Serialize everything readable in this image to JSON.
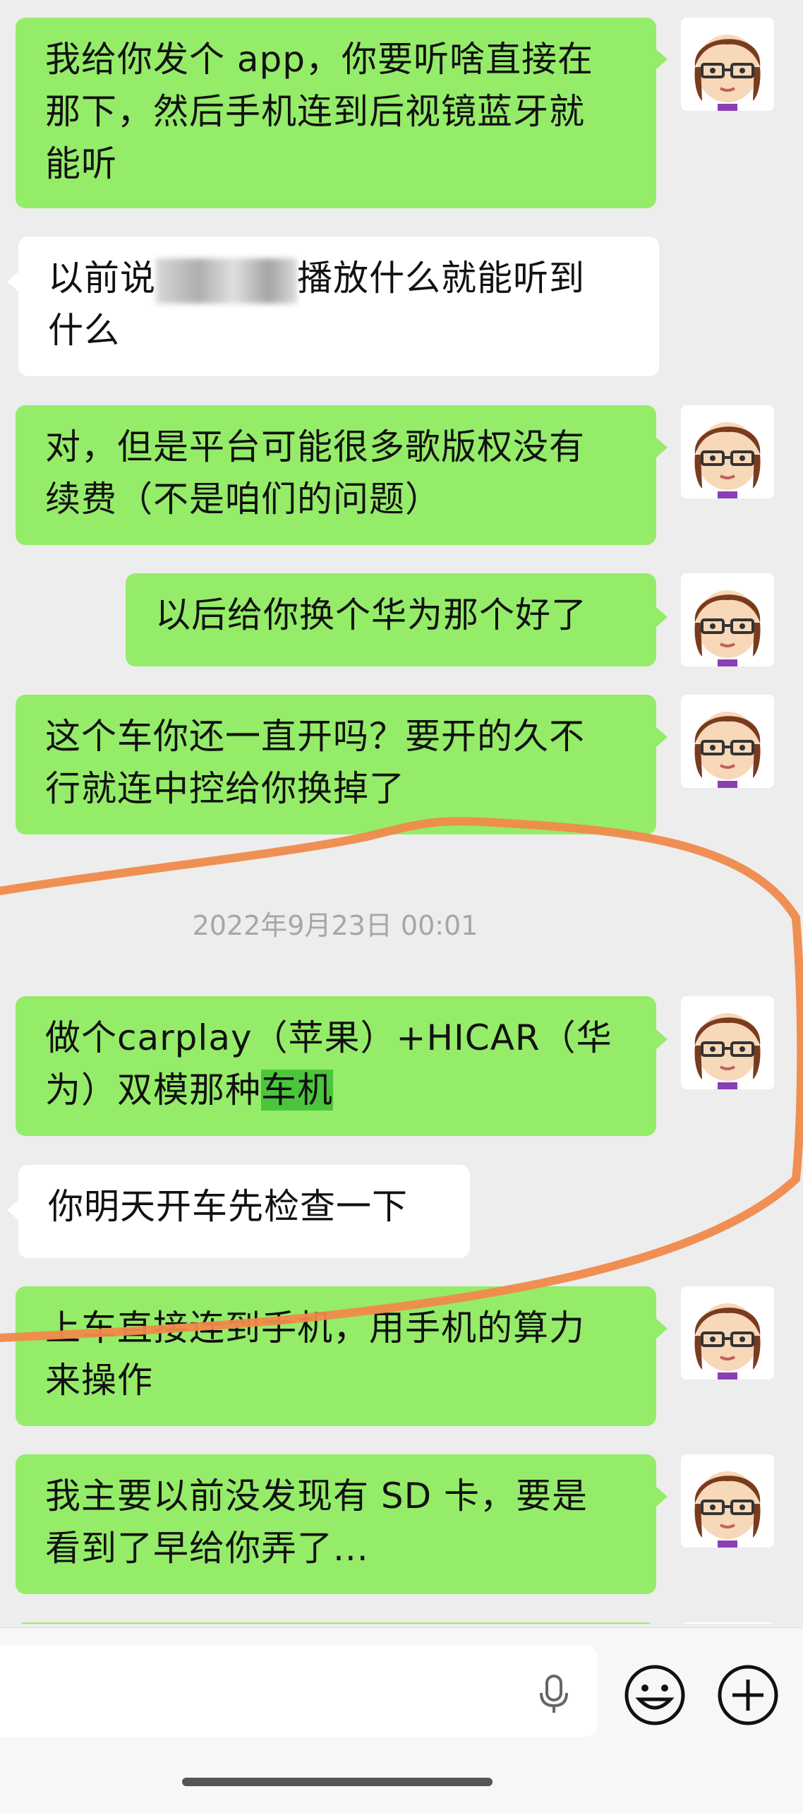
{
  "messages": [
    {
      "side": "right",
      "text": [
        "我给你发个 app，你要听啥直接在",
        "那下，然后手机连到后视镜蓝牙就",
        "能听"
      ]
    },
    {
      "side": "left",
      "text_before": "以前说",
      "text_after": "播放什么就能听到",
      "text2": "什么"
    },
    {
      "side": "right",
      "text": [
        "对，但是平台可能很多歌版权没有",
        "续费（不是咱们的问题）"
      ]
    },
    {
      "side": "right",
      "text": [
        "以后给你换个华为那个好了"
      ]
    },
    {
      "side": "right",
      "text": [
        "这个车你还一直开吗？要开的久不",
        "行就连中控给你换掉了"
      ]
    },
    {
      "side": "right",
      "text_line1": "做个carplay（苹果）+HICAR（华",
      "text_line2_plain": "为）双模那种",
      "text_line2_hl": "车机"
    },
    {
      "side": "left",
      "text": [
        "你明天开车先检查一下"
      ]
    },
    {
      "side": "right",
      "text": [
        "上车直接连到手机，用手机的算力",
        "来操作"
      ]
    },
    {
      "side": "right",
      "text": [
        "我主要以前没发现有 SD 卡，要是",
        "看到了早给你弄了..."
      ]
    }
  ],
  "timestamp": "2022年9月23日 00:01",
  "input_bar": {
    "mic_icon": "microphone-icon",
    "emoji_icon": "emoji-icon",
    "plus_icon": "plus-icon"
  },
  "colors": {
    "bubble_green": "#95ec69",
    "annotation_orange": "#f08a4b",
    "background": "#ededed"
  }
}
